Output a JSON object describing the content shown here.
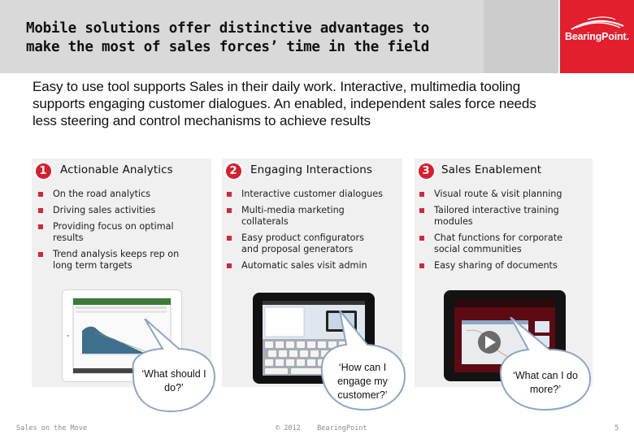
{
  "header": {
    "title_lines": [
      "Mobile solutions offer distinctive advantages to",
      "make the most of sales forces’ time in the field"
    ],
    "logo": "BearingPoint.",
    "brand_color": "#e31e2d"
  },
  "intro": {
    "lines": [
      "Easy to use tool supports Sales in their daily work. Interactive, multimedia tooling",
      "supports engaging customer dialogues. An enabled, independent sales force needs",
      "less steering and control mechanisms to achieve results"
    ]
  },
  "columns": [
    {
      "number": "1",
      "title": "Actionable Analytics",
      "bullets": [
        "On the road analytics",
        "Driving sales activities",
        "Providing focus on optimal results",
        "Trend analysis keeps rep on long term targets"
      ],
      "screenshot_icon": "analytics-dashboard-tablet-icon",
      "quote_lines": [
        "‘What should I",
        "do?’"
      ]
    },
    {
      "number": "2",
      "title": "Engaging Interactions",
      "bullets": [
        "Interactive customer dialogues",
        "Multi-media marketing collaterals",
        "Easy product configurators and proposal generators",
        "Automatic sales visit admin"
      ],
      "screenshot_icon": "keyboard-form-tablet-icon",
      "quote_lines": [
        "‘How can I",
        "engage my",
        "customer?’"
      ]
    },
    {
      "number": "3",
      "title": "Sales Enablement",
      "bullets": [
        "Visual route & visit planning",
        "Tailored interactive training modules",
        "Chat functions for corporate social communities",
        "Easy sharing of documents"
      ],
      "screenshot_icon": "video-map-tablet-icon",
      "quote_lines": [
        "‘What can I do",
        "more?’"
      ]
    }
  ],
  "footer": {
    "left": "Sales on the Move",
    "center": "© 2012    BearingPoint",
    "page_number": "5"
  }
}
